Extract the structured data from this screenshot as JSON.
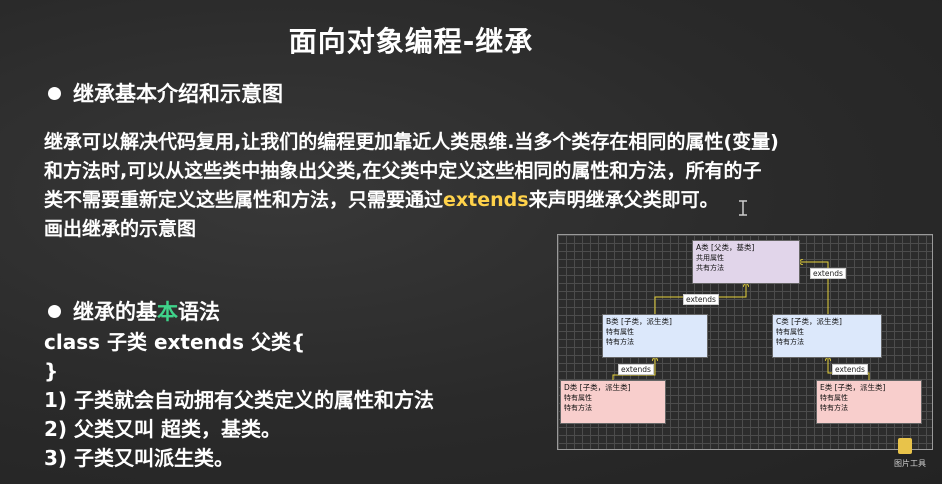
{
  "slide": {
    "title": "面向对象编程-继承",
    "section1_heading": "继承基本介绍和示意图",
    "paragraph": {
      "line1": "继承可以解决代码复用,让我们的编程更加靠近人类思维.当多个类存在相同的属性(变量)",
      "line2": "和方法时,可以从这些类中抽象出父类,在父类中定义这些相同的属性和方法，所有的子",
      "line3_pre": "类不需要重新定义这些属性和方法，只需要通过",
      "line3_keyword": "extends",
      "line3_post": "来声明继承父类即可。",
      "line4": "画出继承的示意图"
    },
    "section2_heading": {
      "pre": "继承的基",
      "highlight": "本",
      "post": "语法"
    },
    "syntax_lines": [
      "class 子类 extends 父类{",
      "}",
      "1) 子类就会自动拥有父类定义的属性和方法",
      "2) 父类又叫 超类，基类。",
      "3) 子类又叫派生类。"
    ]
  },
  "diagram": {
    "nodes": {
      "A": {
        "title": "A类 [父类，基类]",
        "l1": "共用属性",
        "l2": "共有方法"
      },
      "B": {
        "title": "B类 [子类，派生类]",
        "l1": "特有属性",
        "l2": "特有方法"
      },
      "C": {
        "title": "C类 [子类，派生类]",
        "l1": "特有属性",
        "l2": "特有方法"
      },
      "D": {
        "title": "D类 [子类，派生类]",
        "l1": "特有属性",
        "l2": "特有方法"
      },
      "E": {
        "title": "E类 [子类，派生类]",
        "l1": "特有属性",
        "l2": "特有方法"
      }
    },
    "edge_label": "extends",
    "arrow_color": "#e6d23a"
  },
  "taskbar": {
    "app_label": "图片工具"
  },
  "colors": {
    "background": "#2b2b2b",
    "keyword": "#ffd24a",
    "highlight": "#3fd38a"
  }
}
